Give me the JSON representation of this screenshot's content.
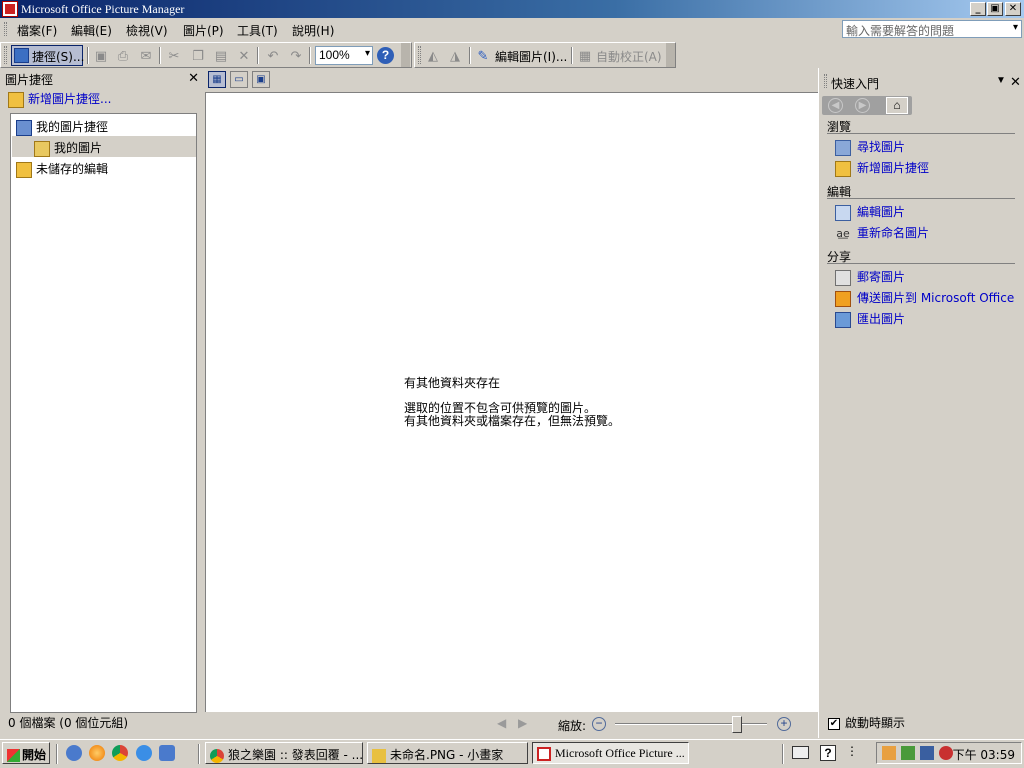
{
  "window": {
    "title": "Microsoft Office Picture Manager"
  },
  "menubar": {
    "items": [
      "檔案(F)",
      "編輯(E)",
      "檢視(V)",
      "圖片(P)",
      "工具(T)",
      "說明(H)"
    ],
    "help_placeholder": "輸入需要解答的問題"
  },
  "toolbar": {
    "shortcut_label": "捷徑(S)...",
    "zoom_value": "100%",
    "edit_picture_label": "編輯圖片(I)...",
    "auto_correct_label": "自動校正(A)"
  },
  "left_pane": {
    "title": "圖片捷徑",
    "add_shortcut": "新增圖片捷徑...",
    "tree": [
      "我的圖片捷徑",
      "我的圖片",
      "未儲存的編輯"
    ],
    "status": "0 個檔案 (0 個位元組)"
  },
  "main": {
    "message_title": "有其他資料夾存在",
    "message_line1": "選取的位置不包含可供預覽的圖片。",
    "message_line2": "有其他資料夾或檔案存在，但無法預覽。",
    "zoom_label": "縮放:",
    "zoom_slider_fraction": 0.8
  },
  "task_pane": {
    "title": "快速入門",
    "sections": [
      {
        "heading": "瀏覽",
        "links": [
          "尋找圖片",
          "新增圖片捷徑"
        ]
      },
      {
        "heading": "編輯",
        "links": [
          "編輯圖片",
          "重新命名圖片"
        ]
      },
      {
        "heading": "分享",
        "links": [
          "郵寄圖片",
          "傳送圖片到 Microsoft Office",
          "匯出圖片"
        ]
      }
    ],
    "startup_label": "啟動時顯示",
    "startup_checked": true
  },
  "taskbar": {
    "start_label": "開始",
    "tasks": [
      "狼之樂園 :: 發表回覆 - ...",
      "未命名.PNG - 小畫家",
      "Microsoft Office Picture ..."
    ],
    "clock": "下午 03:59"
  },
  "colors": {
    "title_bar": "#0a246a",
    "link": "#0000c8",
    "chrome": "#d4d0c8"
  }
}
